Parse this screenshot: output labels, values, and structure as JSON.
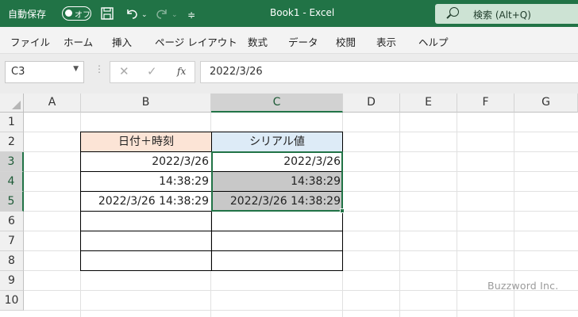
{
  "titlebar": {
    "autosave_label": "自動保存",
    "autosave_state": "オフ",
    "icons": [
      "save-icon",
      "undo-icon",
      "redo-icon",
      "customize-icon"
    ],
    "document_title": "Book1  -  Excel",
    "search_placeholder": "検索 (Alt+Q)"
  },
  "menu": {
    "items": [
      "ファイル",
      "ホーム",
      "挿入",
      "ページ レイアウト",
      "数式",
      "データ",
      "校閲",
      "表示",
      "ヘルプ"
    ]
  },
  "formula_bar": {
    "name_box": "C3",
    "fx_label": "fx",
    "formula_value": "2022/3/26"
  },
  "grid": {
    "column_headers": [
      "A",
      "B",
      "C",
      "D",
      "E",
      "F",
      "G"
    ],
    "row_headers": [
      "1",
      "2",
      "3",
      "4",
      "5",
      "6",
      "7",
      "8",
      "9",
      "10"
    ],
    "table": {
      "header_b": "日付＋時刻",
      "header_c": "シリアル値",
      "rows": [
        {
          "b": "2022/3/26",
          "c": "2022/3/26"
        },
        {
          "b": "14:38:29",
          "c": "14:38:29"
        },
        {
          "b": "2022/3/26 14:38:29",
          "c": "2022/3/26 14:38:29"
        }
      ]
    },
    "selected_range": "C3:C5"
  },
  "watermark": "Buzzword Inc.",
  "colors": {
    "accent": "#217346",
    "header_b_fill": "#fce4d6",
    "header_c_fill": "#ddebf7",
    "selection_fill": "#c8c8c8"
  }
}
